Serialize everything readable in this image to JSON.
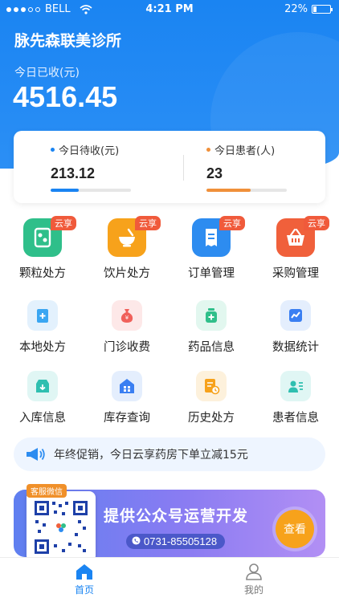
{
  "status_bar": {
    "carrier": "BELL",
    "time": "4:21 PM",
    "battery": "22%",
    "battery_level": 0.22
  },
  "header": {
    "clinic_name": "脉先森联美诊所",
    "received_label": "今日已收(元)",
    "received_value": "4516.45"
  },
  "stats": {
    "pending": {
      "label": "今日待收(元)",
      "value": "213.12",
      "progress": 0.35,
      "color": "#1a84f2"
    },
    "patients": {
      "label": "今日患者(人)",
      "value": "23",
      "progress": 0.55,
      "color": "#f0903a"
    }
  },
  "menu": [
    {
      "label": "颗粒处方",
      "icon": "granule-prescription-icon",
      "tag": "云享",
      "color": "#2fbf8a"
    },
    {
      "label": "饮片处方",
      "icon": "herbal-bowl-icon",
      "tag": "云享",
      "color": "#f7a21b"
    },
    {
      "label": "订单管理",
      "icon": "receipt-icon",
      "tag": "云享",
      "color": "#2d8cf0"
    },
    {
      "label": "采购管理",
      "icon": "basket-icon",
      "tag": "云享",
      "color": "#f0603b"
    },
    {
      "label": "本地处方",
      "icon": "clipboard-plus-icon",
      "tag": "",
      "color": "#3aa6f2"
    },
    {
      "label": "门诊收费",
      "icon": "money-bag-icon",
      "tag": "",
      "color": "#f0605a"
    },
    {
      "label": "药品信息",
      "icon": "medicine-bottle-icon",
      "tag": "",
      "color": "#2fbf8a"
    },
    {
      "label": "数据统计",
      "icon": "chart-icon",
      "tag": "",
      "color": "#3a7ff2"
    },
    {
      "label": "入库信息",
      "icon": "inbox-icon",
      "tag": "",
      "color": "#2fbfb0"
    },
    {
      "label": "库存查询",
      "icon": "warehouse-icon",
      "tag": "",
      "color": "#3a7ff2"
    },
    {
      "label": "历史处方",
      "icon": "history-document-icon",
      "tag": "",
      "color": "#f7a21b"
    },
    {
      "label": "患者信息",
      "icon": "patient-card-icon",
      "tag": "",
      "color": "#2fbfb0"
    }
  ],
  "promo": {
    "text": "年终促销，今日云享药房下单立减15元"
  },
  "banner": {
    "qr_tag": "客服微信",
    "title": "提供公众号运营开发",
    "phone": "0731-85505128",
    "button": "查看"
  },
  "tabbar": {
    "home": "首页",
    "mine": "我的"
  }
}
